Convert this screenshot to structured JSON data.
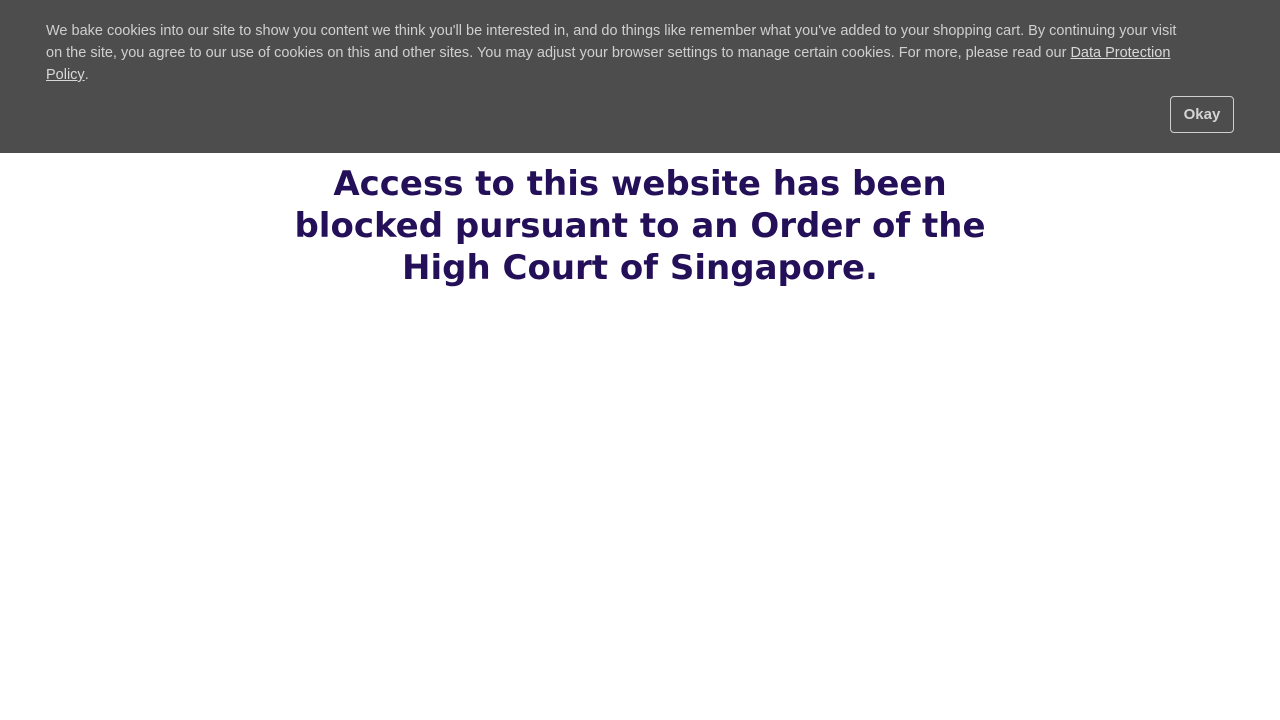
{
  "cookie_banner": {
    "message": "We bake cookies into our site to show you content we think you'll be interested in, and do things like remember what you've added to your shopping cart. By continuing your visit on the site, you agree to our use of cookies on this and other sites. You may adjust your browser settings to manage certain cookies. For more, please read our ",
    "policy_link": "Data Protection Policy",
    "period": ".",
    "okay_label": "Okay"
  },
  "main": {
    "heading": "Access to this website has been blocked pursuant to an Order of the High Court of Singapore."
  },
  "colors": {
    "banner_background": "#4d4d4d",
    "heading_text": "#241059"
  }
}
